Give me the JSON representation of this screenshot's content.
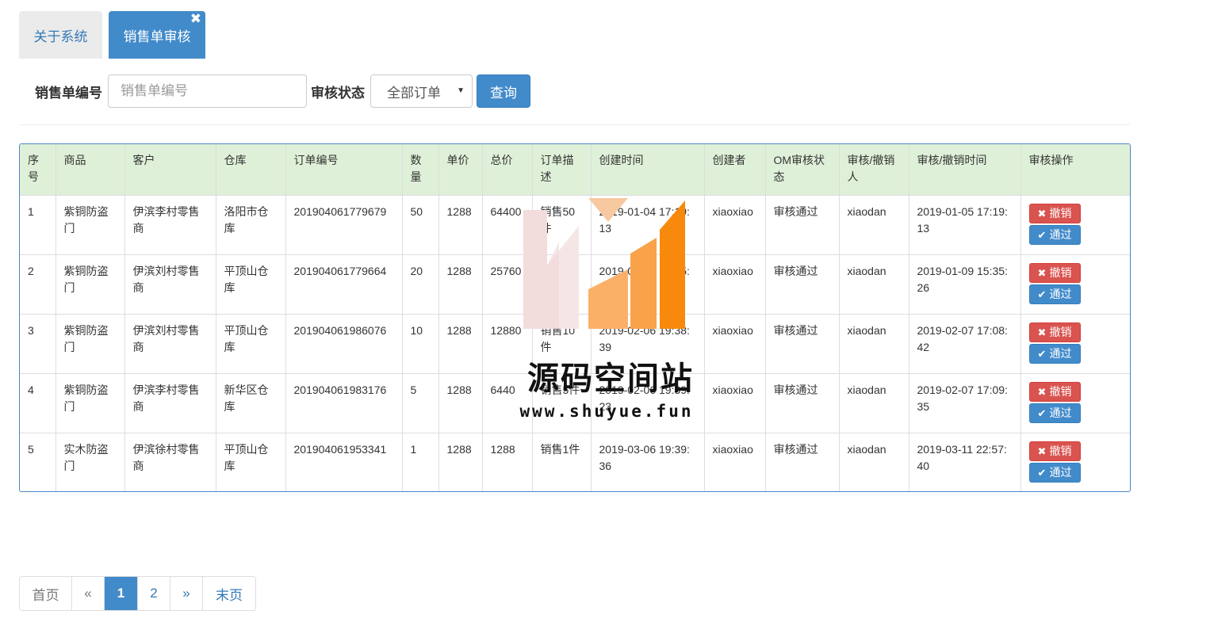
{
  "tabs": [
    {
      "label": "关于系统"
    },
    {
      "label": "销售单审核",
      "close": "✖"
    }
  ],
  "search": {
    "order_label": "销售单编号",
    "order_placeholder": "销售单编号",
    "status_label": "审核状态",
    "status_selected": "全部订单",
    "query_label": "查询"
  },
  "table": {
    "headers": [
      "序号",
      "商品",
      "客户",
      "仓库",
      "订单编号",
      "数量",
      "单价",
      "总价",
      "订单描述",
      "创建时间",
      "创建者",
      "OM审核状态",
      "审核/撤销人",
      "审核/撤销时间",
      "审核操作"
    ],
    "revoke_label": "撤销",
    "pass_label": "通过",
    "rows": [
      {
        "no": "1",
        "product": "紫铜防盗门",
        "customer": "伊滨李村零售商",
        "warehouse": "洛阳市仓库",
        "order_id": "201904061779679",
        "qty": "50",
        "price": "1288",
        "total": "64400",
        "desc": "销售50件",
        "created": "2019-01-04 17:19:13",
        "creator": "xiaoxiao",
        "status": "审核通过",
        "reviewer": "xiaodan",
        "review_time": "2019-01-05 17:19:13"
      },
      {
        "no": "2",
        "product": "紫铜防盗门",
        "customer": "伊滨刘村零售商",
        "warehouse": "平顶山仓库",
        "order_id": "201904061779664",
        "qty": "20",
        "price": "1288",
        "total": "25760",
        "desc": "销售20件",
        "created": "2019-01-06 15:35:26",
        "creator": "xiaoxiao",
        "status": "审核通过",
        "reviewer": "xiaodan",
        "review_time": "2019-01-09 15:35:26"
      },
      {
        "no": "3",
        "product": "紫铜防盗门",
        "customer": "伊滨刘村零售商",
        "warehouse": "平顶山仓库",
        "order_id": "201904061986076",
        "qty": "10",
        "price": "1288",
        "total": "12880",
        "desc": "销售10件",
        "created": "2019-02-06 19:38:39",
        "creator": "xiaoxiao",
        "status": "审核通过",
        "reviewer": "xiaodan",
        "review_time": "2019-02-07 17:08:42"
      },
      {
        "no": "4",
        "product": "紫铜防盗门",
        "customer": "伊滨李村零售商",
        "warehouse": "新华区仓库",
        "order_id": "201904061983176",
        "qty": "5",
        "price": "1288",
        "total": "6440",
        "desc": "销售5件",
        "created": "2019-02-06 19:39:23",
        "creator": "xiaoxiao",
        "status": "审核通过",
        "reviewer": "xiaodan",
        "review_time": "2019-02-07 17:09:35"
      },
      {
        "no": "5",
        "product": "实木防盗门",
        "customer": "伊滨徐村零售商",
        "warehouse": "平顶山仓库",
        "order_id": "201904061953341",
        "qty": "1",
        "price": "1288",
        "total": "1288",
        "desc": "销售1件",
        "created": "2019-03-06 19:39:36",
        "creator": "xiaoxiao",
        "status": "审核通过",
        "reviewer": "xiaodan",
        "review_time": "2019-03-11 22:57:40"
      }
    ]
  },
  "watermark": {
    "title": "源码空间站",
    "url": "www.shuyue.fun"
  },
  "pagination": {
    "first": "首页",
    "prev": "«",
    "pages": [
      "1",
      "2"
    ],
    "current": "1",
    "next": "»",
    "last": "末页"
  },
  "colors": {
    "primary": "#428bca",
    "danger": "#d9534f",
    "header_bg": "#dff0d8",
    "tab_inactive_bg": "#ebebeb"
  }
}
